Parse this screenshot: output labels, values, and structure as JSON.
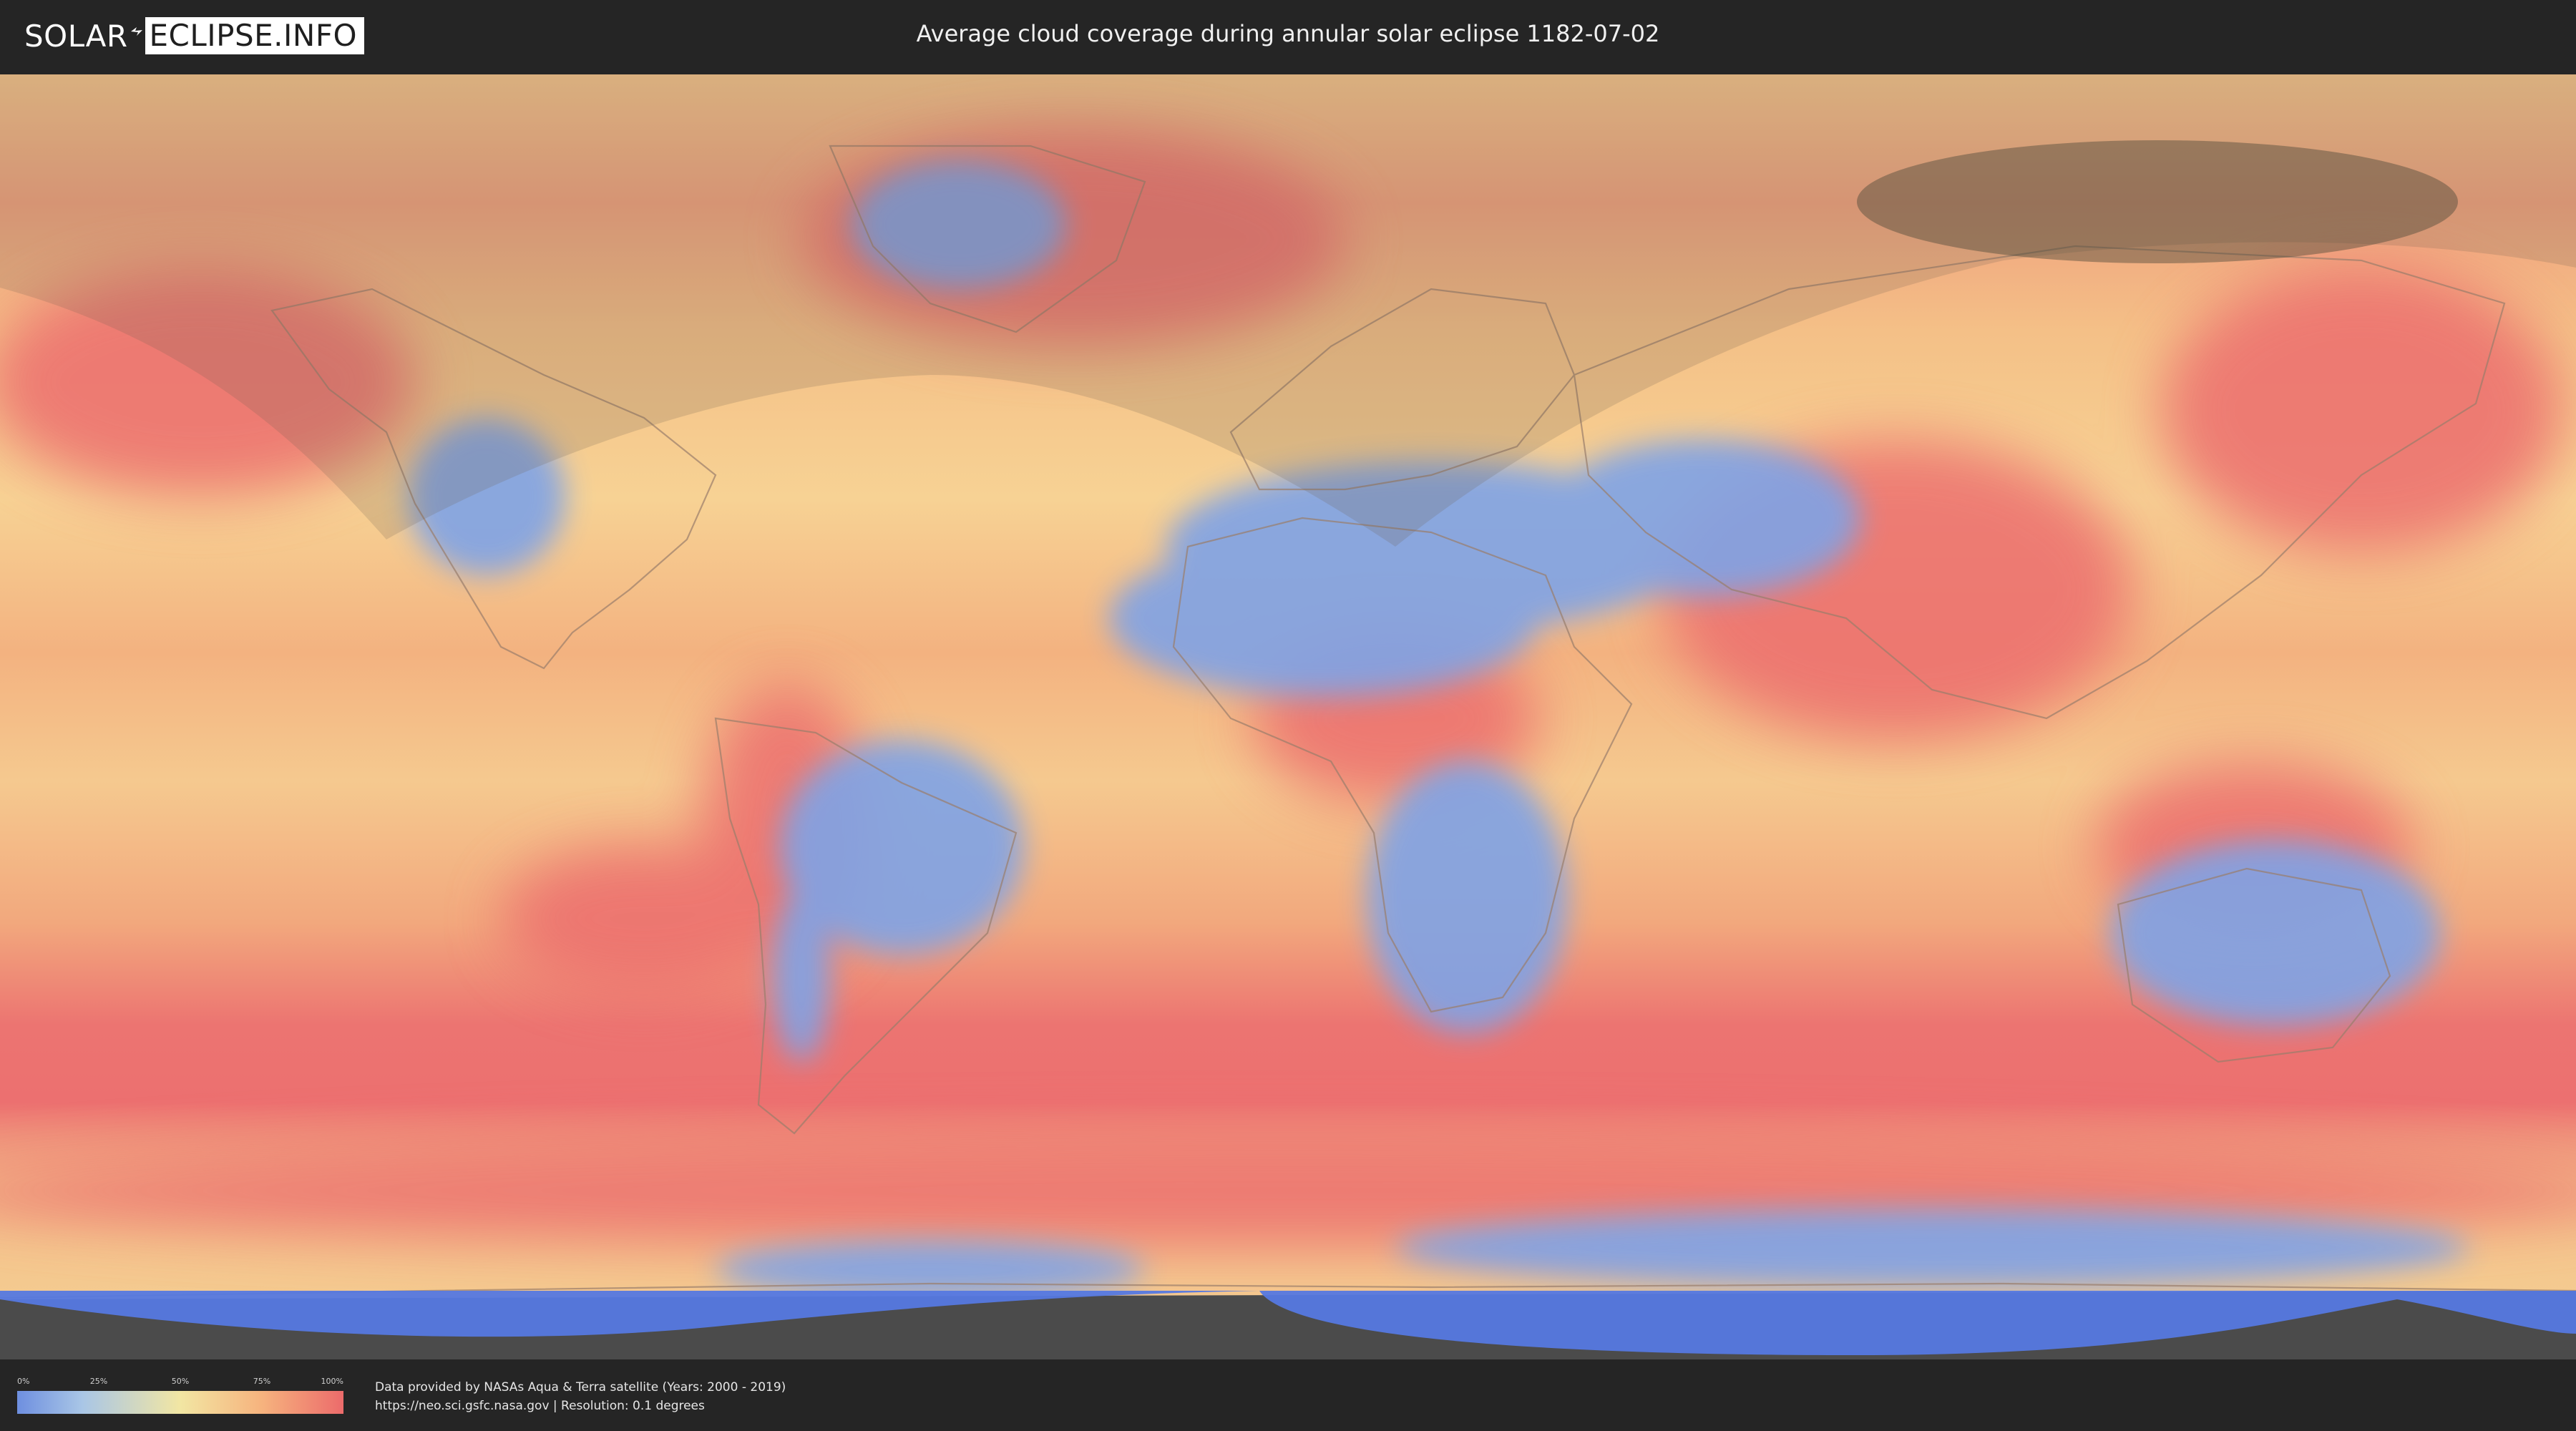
{
  "header": {
    "logo_left": "SOLAR",
    "logo_right": "ECLIPSE.INFO",
    "title": "Average cloud coverage during annular solar eclipse 1182-07-02"
  },
  "legend": {
    "ticks": [
      "0%",
      "25%",
      "50%",
      "75%",
      "100%"
    ],
    "colors": [
      "#6e8fe0",
      "#a9c6e6",
      "#f2e6a3",
      "#f6b37e",
      "#ec6b6b"
    ]
  },
  "footer": {
    "credit_line1": "Data provided by NASAs Aqua & Terra satellite (Years: 2000 - 2019)",
    "credit_line2": "https://neo.sci.gsfc.nasa.gov | Resolution: 0.1 degrees"
  },
  "map": {
    "projection": "equirectangular",
    "colors": {
      "ocean_base": "#f2b27c",
      "high_cloud": "#ec6e6e",
      "low_cloud": "#7fa3e6",
      "no_data": "#4b4b4b",
      "eclipse_band": "#6e5d4f"
    }
  }
}
